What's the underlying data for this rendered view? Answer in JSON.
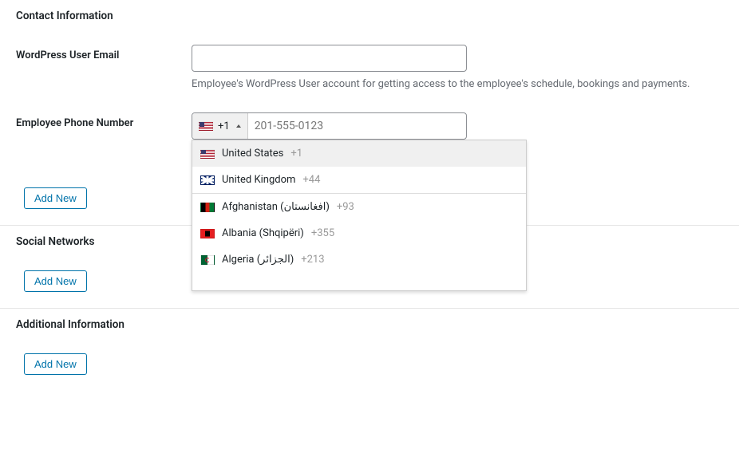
{
  "contact_section": {
    "title": "Contact Information",
    "email_label": "WordPress User Email",
    "email_value": "",
    "email_description": "Employee's WordPress User account for getting access to the employee's schedule, bookings and payments.",
    "phone_label": "Employee Phone Number",
    "phone_selected_code": "+1",
    "phone_placeholder": "201-555-0123",
    "add_new_label": "Add New"
  },
  "country_dropdown": {
    "preferred": [
      {
        "name": "United States",
        "code": "+1",
        "flag": "us"
      },
      {
        "name": "United Kingdom",
        "code": "+44",
        "flag": "uk"
      }
    ],
    "all": [
      {
        "name": "Afghanistan (افغانستان)",
        "code": "+93",
        "flag": "af"
      },
      {
        "name": "Albania (Shqipëri)",
        "code": "+355",
        "flag": "al"
      },
      {
        "name": "Algeria (الجزائر)",
        "code": "+213",
        "flag": "dz"
      }
    ]
  },
  "social_section": {
    "title": "Social Networks",
    "add_new_label": "Add New"
  },
  "additional_section": {
    "title": "Additional Information",
    "add_new_label": "Add New"
  }
}
